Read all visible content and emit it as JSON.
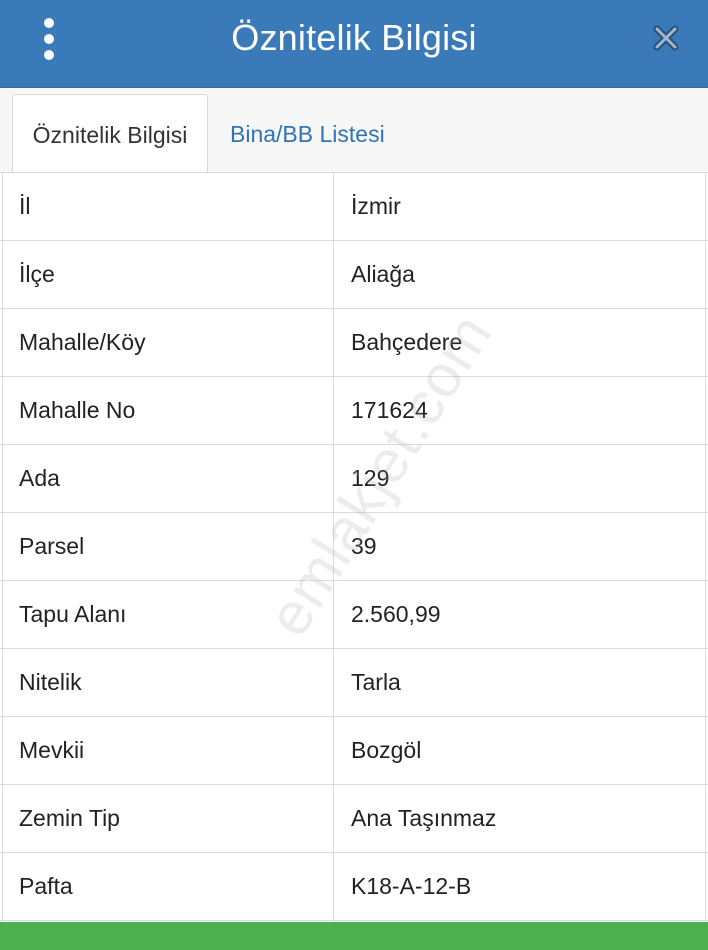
{
  "header": {
    "title": "Öznitelik Bilgisi",
    "menu_icon": "more-vertical-icon",
    "close_icon": "close-icon",
    "background_color": "#3a7ab8"
  },
  "tabs": [
    {
      "label": "Öznitelik Bilgisi",
      "active": true
    },
    {
      "label": "Bina/BB Listesi",
      "active": false
    }
  ],
  "rows": [
    {
      "label": "İl",
      "value": "İzmir"
    },
    {
      "label": "İlçe",
      "value": "Aliağa"
    },
    {
      "label": "Mahalle/Köy",
      "value": "Bahçedere"
    },
    {
      "label": "Mahalle No",
      "value": "171624"
    },
    {
      "label": "Ada",
      "value": "129"
    },
    {
      "label": "Parsel",
      "value": "39"
    },
    {
      "label": "Tapu Alanı",
      "value": "2.560,99"
    },
    {
      "label": "Nitelik",
      "value": "Tarla"
    },
    {
      "label": "Mevkii",
      "value": "Bozgöl"
    },
    {
      "label": "Zemin Tip",
      "value": "Ana Taşınmaz"
    },
    {
      "label": "Pafta",
      "value": "K18-A-12-B"
    }
  ],
  "watermark": "emlakjet.com",
  "footer_color": "#4caf50"
}
